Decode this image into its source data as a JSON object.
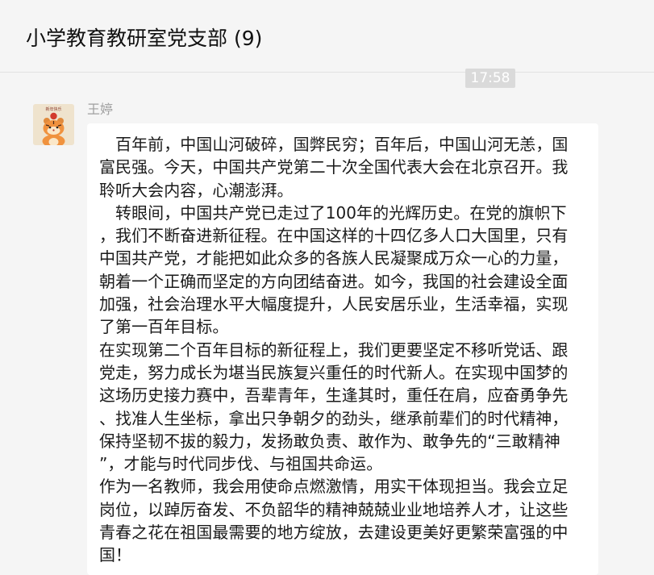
{
  "header": {
    "title": "小学教育教研室党支部 (9)"
  },
  "timestamp": "17:58",
  "message": {
    "sender": "王婷",
    "avatar_icon": "tiger-cartoon-avatar-icon",
    "avatar_text": "新年快乐",
    "lines": [
      "　百年前，中国山河破碎，国弊民穷；百年后，中国山河无恙，国",
      "富民强。今天，中国共产党第二十次全国代表大会在北京召开。我",
      "聆听大会内容，心潮澎湃。",
      "　转眼间，中国共产党已走过了100年的光辉历史。在党的旗帜下",
      "，我们不断奋进新征程。在中国这样的十四亿多人口大国里，只有",
      "中国共产党，才能把如此众多的各族人民凝聚成万众一心的力量，",
      "朝着一个正确而坚定的方向团结奋进。如今，我国的社会建设全面",
      "加强，社会治理水平大幅度提升，人民安居乐业，生活幸福，实现",
      "了第一百年目标。",
      "在实现第二个百年目标的新征程上，我们更要坚定不移听党话、跟",
      "党走，努力成长为堪当民族复兴重任的时代新人。在实现中国梦的",
      "这场历史接力赛中，吾辈青年，生逢其时，重任在肩，应奋勇争先",
      "、找准人生坐标，拿出只争朝夕的劲头，继承前辈们的时代精神，",
      "保持坚韧不拔的毅力，发扬敢负责、敢作为、敢争先的“三敢精神",
      "”，才能与时代同步伐、与祖国共命运。",
      "作为一名教师，我会用使命点燃激情，用实干体现担当。我会立足",
      "岗位，以踔厉奋发、不负韶华的精神兢兢业业地培养人才，让这些",
      "青春之花在祖国最需要的地方绽放，去建设更美好更繁荣富强的中",
      "国！"
    ]
  },
  "colors": {
    "background": "#f5f5f5",
    "bubble": "#ffffff",
    "timestamp_bg": "#dadada",
    "sender_name": "#a0a0a0"
  }
}
